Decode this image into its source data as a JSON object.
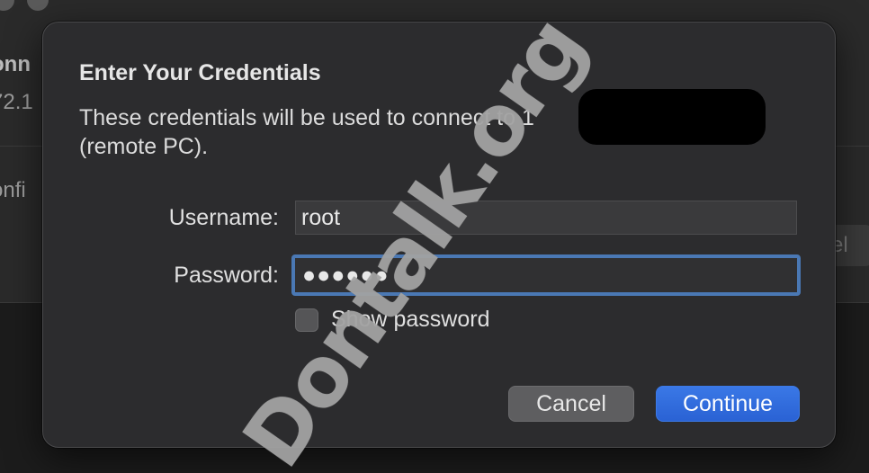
{
  "background_window": {
    "text_1": "onn",
    "text_2": "72.1",
    "text_3": "onfi",
    "button_fragment": "cel"
  },
  "dialog": {
    "title": "Enter Your Credentials",
    "message": "These credentials will be used to connect to 1",
    "message_line2": "(remote PC).",
    "username_label": "Username:",
    "username_value": "root",
    "password_label": "Password:",
    "password_value": "●●●●●●",
    "show_password_label": "Show password",
    "show_password_checked": false,
    "cancel_label": "Cancel",
    "continue_label": "Continue"
  },
  "watermark": "Dontalk.org",
  "colors": {
    "accent": "#2a62d4",
    "focus_ring": "#4a78b4",
    "sheet_bg": "#2c2c2e"
  }
}
